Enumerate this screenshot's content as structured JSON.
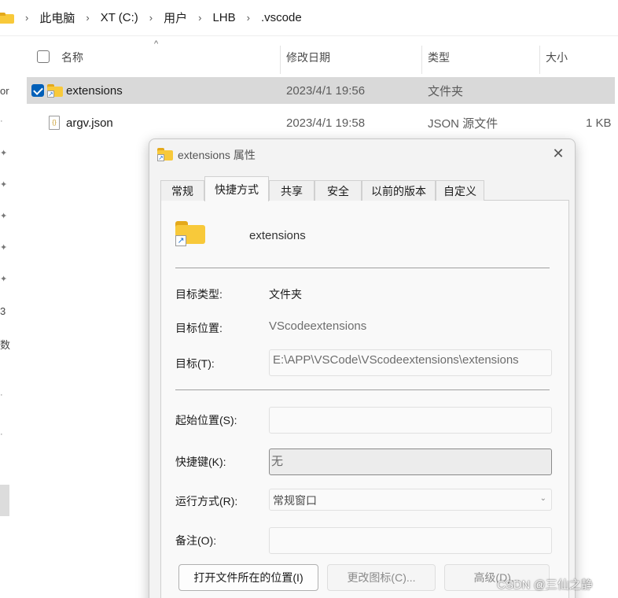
{
  "address_bar": {
    "crumbs": [
      "此电脑",
      "XT (C:)",
      "用户",
      "LHB",
      ".vscode"
    ]
  },
  "nav_strip": {
    "fragments": [
      "or",
      "3",
      "数"
    ]
  },
  "file_list": {
    "columns": {
      "name": "名称",
      "modified": "修改日期",
      "type": "类型",
      "size": "大小"
    },
    "rows": [
      {
        "name": "extensions",
        "modified": "2023/4/1 19:56",
        "type": "文件夹",
        "size": "",
        "selected": true,
        "icon": "folder-shortcut-icon"
      },
      {
        "name": "argv.json",
        "modified": "2023/4/1 19:58",
        "type": "JSON 源文件",
        "size": "1 KB",
        "selected": false,
        "icon": "json-file-icon"
      }
    ]
  },
  "dialog": {
    "title": "extensions 属性",
    "close_symbol": "✕",
    "tabs": [
      {
        "label": "常规",
        "active": false
      },
      {
        "label": "快捷方式",
        "active": true
      },
      {
        "label": "共享",
        "active": false
      },
      {
        "label": "安全",
        "active": false
      },
      {
        "label": "以前的版本",
        "active": false
      },
      {
        "label": "自定义",
        "active": false
      }
    ],
    "shortcut": {
      "name": "extensions",
      "target_type_label": "目标类型:",
      "target_type": "文件夹",
      "target_location_label": "目标位置:",
      "target_location": "VScodeextensions",
      "target_label": "目标(T):",
      "target": "E:\\APP\\VSCode\\VScodeextensions\\extensions",
      "start_in_label": "起始位置(S):",
      "start_in": "",
      "hotkey_label": "快捷键(K):",
      "hotkey": "无",
      "run_label": "运行方式(R):",
      "run": "常规窗口",
      "comment_label": "备注(O):",
      "comment": ""
    },
    "buttons": {
      "open_location": "打开文件所在的位置(I)",
      "change_icon": "更改图标(C)...",
      "advanced": "高级(D)..."
    }
  },
  "watermark": "CSDN @三仙之静",
  "colors": {
    "folder": "#f8c93a",
    "selection": "#d9d9d9",
    "checkbox_accent": "#005fb8"
  }
}
